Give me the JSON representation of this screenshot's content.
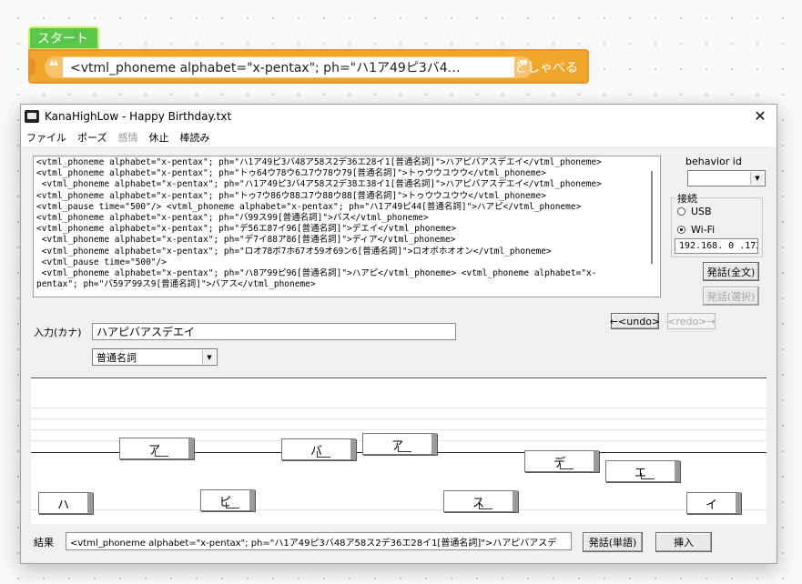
{
  "blocks": {
    "start_label": "スタート",
    "say_text": "<vtml_phoneme alphabet=\"x-pentax\"; ph=\"ハ1ア49ピ3バ4…",
    "quote_open": "❝",
    "quote_close": "❞",
    "say_action": "としゃべる"
  },
  "window": {
    "title": "KanaHighLow - Happy Birthday.txt",
    "close_symbol": "✕"
  },
  "menu": [
    {
      "label": "ファイル",
      "enabled": true
    },
    {
      "label": "ポーズ",
      "enabled": true
    },
    {
      "label": "感情",
      "enabled": false
    },
    {
      "label": "休止",
      "enabled": true
    },
    {
      "label": "棒読み",
      "enabled": true
    }
  ],
  "editor": {
    "lines": [
      "<vtml_phoneme alphabet=\"x-pentax\"; ph=\"ハ1ア49ピ3バ48ア58ス2デ36エ28イ1[普通名詞]\">ハアピバアスデエイ</vtml_phoneme>",
      "<vtml_phoneme alphabet=\"x-pentax\"; ph=\"トゥ64ウ78ウ6ユ7ウ78ウ79[普通名詞]\">トゥウウユウウ</vtml_phoneme>",
      " <vtml_phoneme alphabet=\"x-pentax\"; ph=\"ハ1ア49ピ3バ4ア58ス2デ38エ38イ1[普通名詞]\">ハアピバアスデエイ</vtml_phoneme>",
      "<vtml_phoneme alphabet=\"x-pentax\"; ph=\"トゥ7ウ86ウ88ユ7ウ88ウ88[普通名詞]\">トゥウウユウウ</vtml_phoneme>",
      "<vtml_pause time=\"500\"/> <vtml_phoneme alphabet=\"x-pentax\"; ph=\"ハ1ア49ピ44[普通名詞]\">ハアピ</vtml_phoneme>",
      "<vtml_phoneme alphabet=\"x-pentax\"; ph=\"バ99ス99[普通名詞]\">バス</vtml_phoneme>",
      "<vtml_phoneme alphabet=\"x-pentax\"; ph=\"デ56エ87イ96[普通名詞]\">デエイ</vtml_phoneme>",
      " <vtml_phoneme alphabet=\"x-pentax\"; ph=\"デ7イ88ア86[普通名詞]\">ディア</vtml_phoneme>",
      " <vtml_phoneme alphabet=\"x-pentax\"; ph=\"ロオ78ボ7ホ67オ59オ69ン6[普通名詞]\">ロオボホオオン</vtml_phoneme>",
      " <vtml_pause time=\"500\"/>",
      " <vtml_phoneme alphabet=\"x-pentax\"; ph=\"ハ8ア99ピ96[普通名詞]\">ハアピ</vtml_phoneme> <vtml_phoneme alphabet=\"x-",
      "pentax\"; ph=\"バ59ア99ス9[普通名詞]\">バアス</vtml_phoneme>"
    ]
  },
  "side": {
    "behavior_label": "behavior id",
    "behavior_value": "",
    "connection_label": "接続",
    "usb_label": "USB",
    "wifi_label": "Wi-Fi",
    "usb_selected": false,
    "wifi_selected": true,
    "ip_value": "192.168. 0 .173",
    "speak_all_label": "発話(全文)",
    "speak_sel_label": "発話(選択)"
  },
  "undo": {
    "undo_label": "←<undo>",
    "redo_label": "<redo>→"
  },
  "input": {
    "label": "入力(カナ)",
    "value": "ハアピバアスデエイ",
    "pos_value": "普通名詞"
  },
  "pitch": {
    "kana": [
      "ハ",
      "ア",
      "ピ",
      "バ",
      "ア",
      "ス",
      "デ",
      "エ",
      "イ"
    ],
    "levels": [
      1,
      49,
      3,
      48,
      58,
      2,
      36,
      28,
      1
    ]
  },
  "result": {
    "label": "結果",
    "value": "<vtml_phoneme alphabet=\"x-pentax\"; ph=\"ハ1ア49ピ3バ48ア58ス2デ36エ28イ1[普通名詞]\">ハアピバアスデ",
    "speak_word_label": "発話(単語)",
    "insert_label": "挿入"
  }
}
